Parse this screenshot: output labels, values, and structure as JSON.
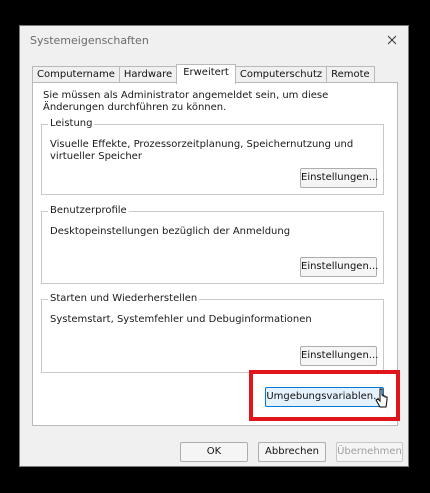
{
  "window": {
    "title": "Systemeigenschaften"
  },
  "tabs": [
    {
      "label": "Computername"
    },
    {
      "label": "Hardware"
    },
    {
      "label": "Erweitert"
    },
    {
      "label": "Computerschutz"
    },
    {
      "label": "Remote"
    }
  ],
  "active_tab": "Erweitert",
  "panel": {
    "admin_note": "Sie müssen als Administrator angemeldet sein, um diese Änderungen durchführen zu können.",
    "groups": [
      {
        "title": "Leistung",
        "description": "Visuelle Effekte, Prozessorzeitplanung, Speichernutzung und virtueller Speicher",
        "button": "Einstellungen..."
      },
      {
        "title": "Benutzerprofile",
        "description": "Desktopeinstellungen bezüglich der Anmeldung",
        "button": "Einstellungen..."
      },
      {
        "title": "Starten und Wiederherstellen",
        "description": "Systemstart, Systemfehler und Debuginformationen",
        "button": "Einstellungen..."
      }
    ],
    "env_button": "Umgebungsvariablen..."
  },
  "footer": {
    "ok": "OK",
    "cancel": "Abbrechen",
    "apply": "Übernehmen"
  },
  "colors": {
    "highlight": "#e0141a",
    "focus": "#0078d7"
  }
}
